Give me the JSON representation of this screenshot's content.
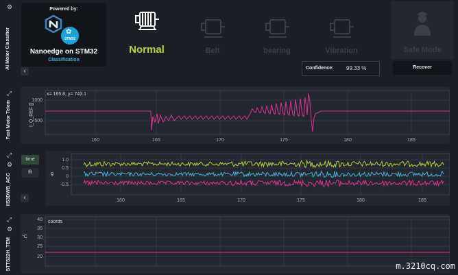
{
  "classifier": {
    "side_title": "AI Motor Classifier",
    "powered_by": "Powered by:",
    "chip_badge": "STM32",
    "product_name": "Nanoedge on STM32",
    "product_sub": "Classification"
  },
  "states": [
    {
      "label": "Normal",
      "icon": "motor-icon",
      "active": true
    },
    {
      "label": "Belt",
      "icon": "motor-icon",
      "active": false
    },
    {
      "label": "bearing",
      "icon": "motor-icon",
      "active": false
    },
    {
      "label": "Vibration",
      "icon": "motor-icon",
      "active": false
    },
    {
      "label": "Safe Mode",
      "icon": "worker-icon",
      "active": false
    }
  ],
  "confidence": {
    "label": "Confidence:",
    "value": "99.33 %"
  },
  "recover_label": "Recover",
  "colors": {
    "pink": "#e0338f",
    "lime": "#b7d53a",
    "cyan": "#3fb8e2",
    "active_green": "#b9d631",
    "bg": "#1c1f26"
  },
  "chart1": {
    "side_title": "Fast Motor Telem",
    "coords": "x= 165.8, y= 743.1",
    "ylabel": "I_Q_REF []",
    "yticks": [
      "1000",
      "500"
    ],
    "xticks": [
      "160",
      "165",
      "170",
      "175",
      "180",
      "185"
    ]
  },
  "chart2": {
    "side_title": "IIS3DWB_ACC",
    "time_label": "time",
    "fft_label": "fft",
    "ylabel": "g",
    "yticks": [
      "1.0",
      "0.5",
      "0",
      "-0.5"
    ],
    "xticks": [
      "160",
      "165",
      "170",
      "175",
      "180",
      "185"
    ]
  },
  "chart3": {
    "side_title": "STTS22H_TEM",
    "coords": "coords",
    "ylabel": "°C",
    "yticks": [
      "40",
      "35",
      "30",
      "25",
      "20"
    ]
  },
  "watermark": "m.3210cq.com"
}
